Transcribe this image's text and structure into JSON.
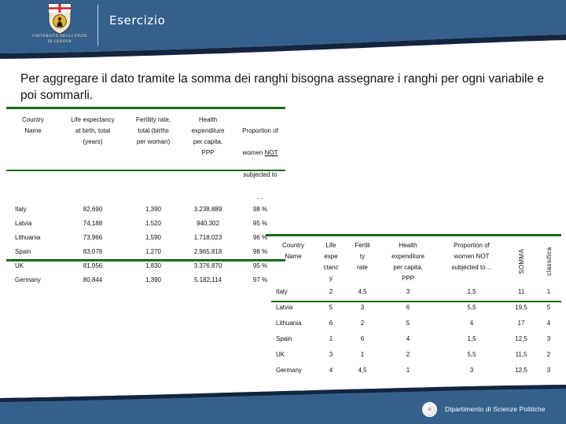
{
  "header": {
    "slide_title": "Esercizio",
    "university_name": "UNIVERSITÀ DEGLI STUDI\nDI GENOVA",
    "logo_icon": "shield-crest-icon",
    "banner_color": "#35608C",
    "banner_accent_color": "#15243F"
  },
  "heading": {
    "text": "Per aggregare il dato tramite la somma dei ranghi bisogna assegnare i ranghi per ogni variabile e poi sommarli."
  },
  "accent": {
    "rule_color": "#1A6B1A"
  },
  "table_left": {
    "name": "raw-values-table",
    "headers": [
      "Country\nName",
      "Life expectancy\nat birth, total\n(years)",
      "Fertility rate,\ntotal (births\nper woman)",
      "Health\nexpenditure\nper capita,\nPPP",
      "Proportion of\nwomen NOT\nsubjected to\n…"
    ],
    "header_not_emphasis": "NOT",
    "rows": [
      {
        "country": "Italy",
        "life_expectancy": "82,690",
        "fertility_rate": "1,390",
        "health_expenditure": "3.238,889",
        "proportion_women": "98 %"
      },
      {
        "country": "Latvia",
        "life_expectancy": "74,188",
        "fertility_rate": "1,520",
        "health_expenditure": "940,302",
        "proportion_women": "95 %"
      },
      {
        "country": "Lithuania",
        "life_expectancy": "73,966",
        "fertility_rate": "1,590",
        "health_expenditure": "1.718,023",
        "proportion_women": "96 %"
      },
      {
        "country": "Spain",
        "life_expectancy": "83,078",
        "fertility_rate": "1,270",
        "health_expenditure": "2.965,818",
        "proportion_women": "98 %"
      },
      {
        "country": "UK",
        "life_expectancy": "81,056",
        "fertility_rate": "1,830",
        "health_expenditure": "3.376,870",
        "proportion_women": "95 %"
      },
      {
        "country": "Germany",
        "life_expectancy": "80,844",
        "fertility_rate": "1,390",
        "health_expenditure": "5.182,114",
        "proportion_women": "97 %"
      }
    ]
  },
  "table_right": {
    "name": "ranks-table",
    "headers": [
      "Country\nName",
      "Life\nexpe\nctanc\ny",
      "Fertili\nty\nrate",
      "Health\nexpenditure\nper capita,\nPPP",
      "Proportion of\nwomen NOT\nsubjected to…",
      "SOMMA",
      "classifica"
    ],
    "rotated_headers": [
      "SOMMA",
      "classifica"
    ],
    "rows": [
      {
        "country": "Italy",
        "life_expectancy": "2",
        "fertility_rate": "4,5",
        "health_expenditure": "3",
        "proportion_women": "1,5",
        "somma": "11",
        "classifica": "1"
      },
      {
        "country": "Latvia",
        "life_expectancy": "5",
        "fertility_rate": "3",
        "health_expenditure": "6",
        "proportion_women": "5,5",
        "somma": "19,5",
        "classifica": "5"
      },
      {
        "country": "Lithuania",
        "life_expectancy": "6",
        "fertility_rate": "2",
        "health_expenditure": "5",
        "proportion_women": "4",
        "somma": "17",
        "classifica": "4"
      },
      {
        "country": "Spain",
        "life_expectancy": "1",
        "fertility_rate": "6",
        "health_expenditure": "4",
        "proportion_women": "1,5",
        "somma": "12,5",
        "classifica": "3"
      },
      {
        "country": "UK",
        "life_expectancy": "3",
        "fertility_rate": "1",
        "health_expenditure": "2",
        "proportion_women": "5,5",
        "somma": "11,5",
        "classifica": "2"
      },
      {
        "country": "Germany",
        "life_expectancy": "4",
        "fertility_rate": "4,5",
        "health_expenditure": "1",
        "proportion_women": "3",
        "somma": "12,5",
        "classifica": "3"
      }
    ]
  },
  "footer": {
    "department": "Dipartimento di Scienze  Politiche",
    "logo_icon": "department-seal-icon",
    "bar_color": "#35608C",
    "accent_color": "#15243F"
  }
}
